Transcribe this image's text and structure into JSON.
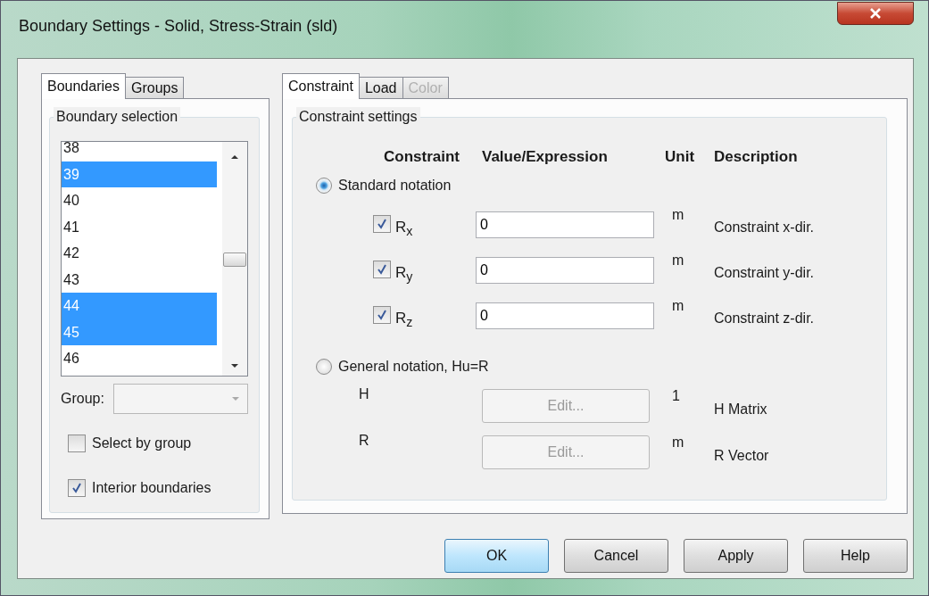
{
  "window": {
    "title": "Boundary Settings - Solid, Stress-Strain (sld)"
  },
  "left_tabs": [
    {
      "label": "Boundaries",
      "selected": true
    },
    {
      "label": "Groups",
      "selected": false
    }
  ],
  "boundary_selection": {
    "title": "Boundary selection",
    "items": [
      {
        "label": "38",
        "selected": false
      },
      {
        "label": "39",
        "selected": true
      },
      {
        "label": "40",
        "selected": false
      },
      {
        "label": "41",
        "selected": false
      },
      {
        "label": "42",
        "selected": false
      },
      {
        "label": "43",
        "selected": false
      },
      {
        "label": "44",
        "selected": true
      },
      {
        "label": "45",
        "selected": true
      },
      {
        "label": "46",
        "selected": false
      }
    ],
    "group": {
      "label": "Group:",
      "disabled": true
    },
    "checkboxes": [
      {
        "label": "Select by group",
        "checked": false
      },
      {
        "label": "Interior boundaries",
        "checked": true
      }
    ]
  },
  "right_tabs": [
    {
      "label": "Constraint",
      "selected": true,
      "disabled": false
    },
    {
      "label": "Load",
      "selected": false,
      "disabled": false
    },
    {
      "label": "Color",
      "selected": false,
      "disabled": true
    }
  ],
  "constraint_settings": {
    "title": "Constraint settings",
    "columns": [
      "Constraint",
      "Value/Expression",
      "Unit",
      "Description"
    ],
    "standard": {
      "label": "Standard notation",
      "selected": true
    },
    "rows": [
      {
        "label": "R$_{x}$",
        "checked": true,
        "value": "0",
        "unit": "m",
        "description": "Constraint x-dir."
      },
      {
        "label": "R$_{y}$",
        "checked": true,
        "value": "0",
        "unit": "m",
        "description": "Constraint y-dir."
      },
      {
        "label": "R$_{z}$",
        "checked": true,
        "value": "0",
        "unit": "m",
        "description": "Constraint z-dir."
      }
    ],
    "general": {
      "label": "General notation, Hu=R",
      "selected": false
    },
    "edit_rows": [
      {
        "label": "H",
        "button": "Edit...",
        "disabled": true,
        "unit": "1",
        "description": "H Matrix"
      },
      {
        "label": "R",
        "button": "Edit...",
        "disabled": true,
        "unit": "m",
        "description": "R Vector"
      }
    ]
  },
  "buttons": [
    {
      "label": "OK",
      "default": true
    },
    {
      "label": "Cancel",
      "default": false
    },
    {
      "label": "Apply",
      "default": false
    },
    {
      "label": "Help",
      "default": false
    }
  ]
}
